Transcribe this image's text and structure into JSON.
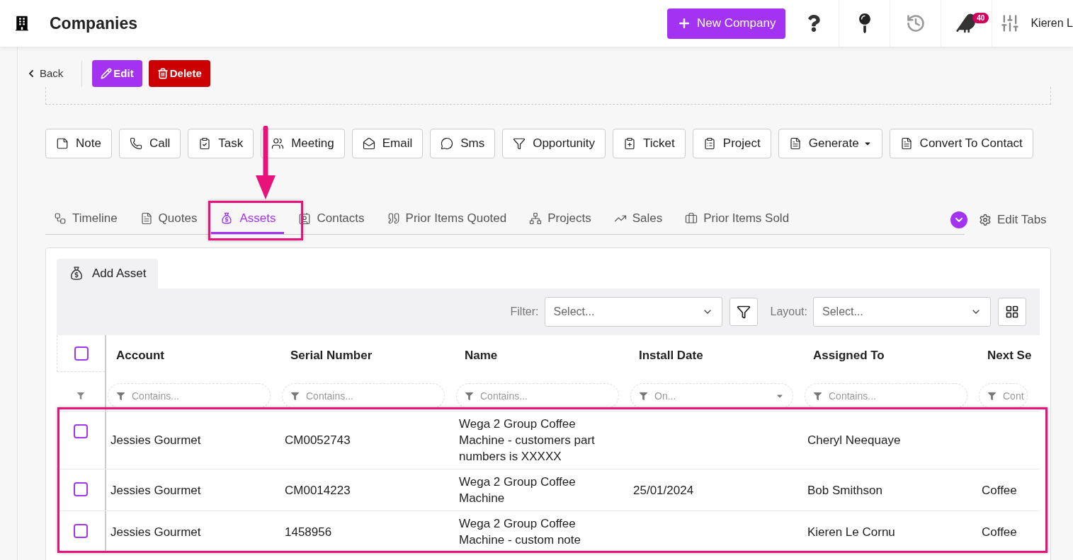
{
  "header": {
    "title": "Companies",
    "new_button": "New Company",
    "notification_count": "40",
    "user_name": "Kieren L"
  },
  "toolbar": {
    "back": "Back",
    "edit": "Edit",
    "delete": "Delete"
  },
  "actions": [
    {
      "label": "Note",
      "kind": "note",
      "dropdown": false
    },
    {
      "label": "Call",
      "kind": "call",
      "dropdown": false
    },
    {
      "label": "Task",
      "kind": "task",
      "dropdown": false
    },
    {
      "label": "Meeting",
      "kind": "meeting",
      "dropdown": false
    },
    {
      "label": "Email",
      "kind": "email",
      "dropdown": false
    },
    {
      "label": "Sms",
      "kind": "sms",
      "dropdown": false
    },
    {
      "label": "Opportunity",
      "kind": "opportunity",
      "dropdown": false
    },
    {
      "label": "Ticket",
      "kind": "ticket",
      "dropdown": false
    },
    {
      "label": "Project",
      "kind": "project",
      "dropdown": false
    },
    {
      "label": "Generate",
      "kind": "document",
      "dropdown": true
    },
    {
      "label": "Convert To Contact",
      "kind": "document",
      "dropdown": false
    }
  ],
  "tabs": [
    {
      "label": "Timeline",
      "kind": "timeline",
      "selected": false
    },
    {
      "label": "Quotes",
      "kind": "quotes",
      "selected": false
    },
    {
      "label": "Assets",
      "kind": "assets",
      "selected": true
    },
    {
      "label": "Contacts",
      "kind": "contacts",
      "selected": false
    },
    {
      "label": "Prior Items Quoted",
      "kind": "quoted",
      "selected": false
    },
    {
      "label": "Projects",
      "kind": "projects",
      "selected": false
    },
    {
      "label": "Sales",
      "kind": "sales",
      "selected": false
    },
    {
      "label": "Prior Items Sold",
      "kind": "sold",
      "selected": false
    }
  ],
  "edit_tabs": "Edit Tabs",
  "add_asset": "Add Asset",
  "filter": {
    "label": "Filter:",
    "placeholder": "Select..."
  },
  "layout": {
    "label": "Layout:",
    "placeholder": "Select..."
  },
  "table": {
    "select_all_checked": false,
    "columns": [
      {
        "title": "Account",
        "filter_placeholder": "Contains...",
        "filter_dropdown": false
      },
      {
        "title": "Serial Number",
        "filter_placeholder": "Contains...",
        "filter_dropdown": false
      },
      {
        "title": "Name",
        "filter_placeholder": "Contains...",
        "filter_dropdown": false
      },
      {
        "title": "Install Date",
        "filter_placeholder": "On...",
        "filter_dropdown": true
      },
      {
        "title": "Assigned To",
        "filter_placeholder": "Contains...",
        "filter_dropdown": false
      },
      {
        "title": "Next Se",
        "filter_placeholder": "Cont",
        "filter_dropdown": false
      }
    ],
    "rows": [
      {
        "checked": false,
        "cells": [
          "Jessies Gourmet",
          "CM0052743",
          "Wega 2 Group Coffee Machine - customers part numbers is XXXXX",
          null,
          "Cheryl Neequaye",
          null
        ]
      },
      {
        "checked": false,
        "cells": [
          "Jessies Gourmet",
          "CM0014223",
          "Wega 2 Group Coffee Machine",
          "25/01/2024",
          "Bob Smithson",
          "Coffee"
        ]
      },
      {
        "checked": false,
        "cells": [
          "Jessies Gourmet",
          "1458956",
          "Wega 2 Group Coffee Machine - custom note",
          null,
          "Kieren Le Cornu",
          "Coffee"
        ]
      }
    ]
  }
}
